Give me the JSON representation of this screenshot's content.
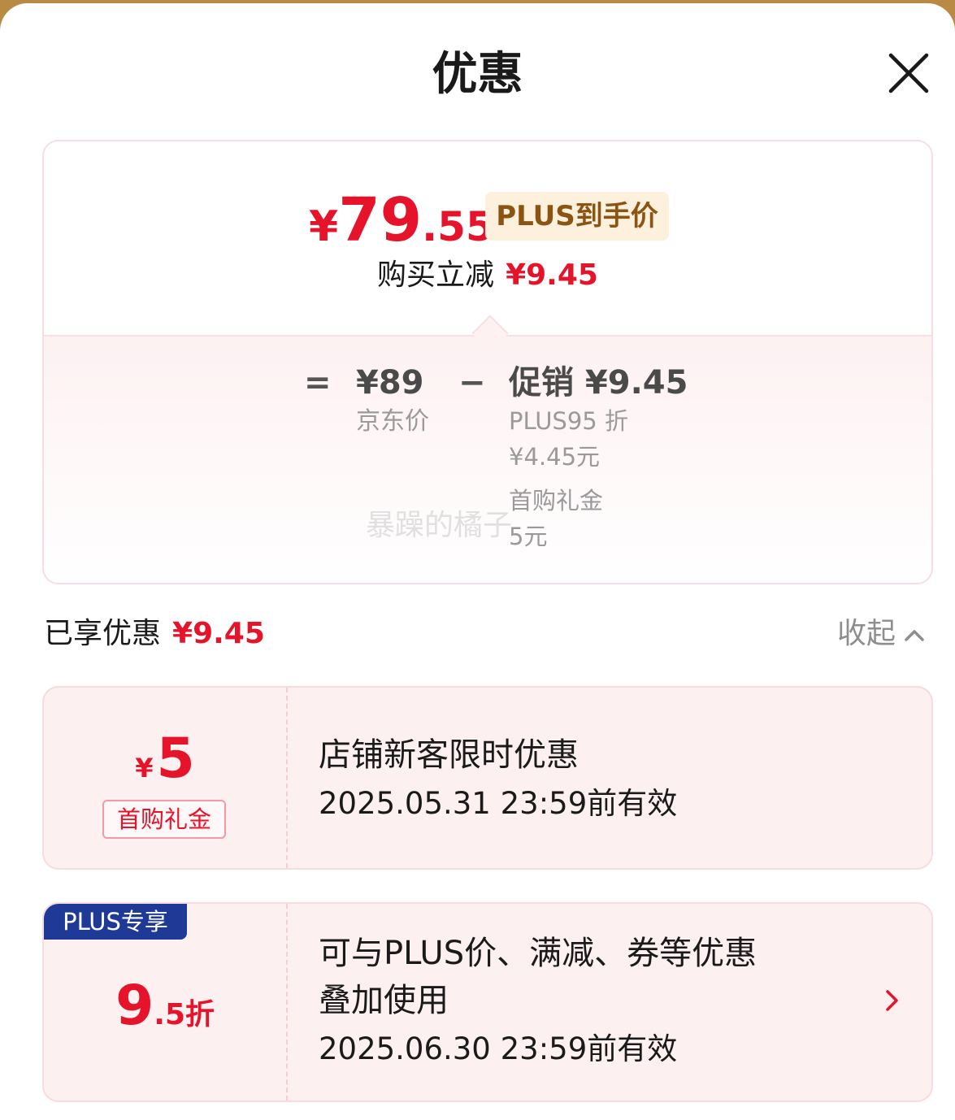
{
  "dialog": {
    "title": "优惠"
  },
  "price_card": {
    "currency_symbol": "¥",
    "final_price_int": "79",
    "final_price_dec": ".55",
    "final_price_label": "PLUS到手价",
    "reduce_label": "购买立减",
    "reduce_amount": "¥9.45",
    "breakdown": {
      "equals": "=",
      "jd_price": "¥89",
      "jd_price_label": "京东价",
      "minus": "−",
      "promo_title": "促销 ¥9.45",
      "promo_details": [
        "PLUS95 折",
        "¥4.45元",
        "首购礼金",
        "5元"
      ]
    },
    "watermark": "暴躁的橘子"
  },
  "savings": {
    "label": "已享优惠",
    "amount": "¥9.45",
    "collapse_label": "收起"
  },
  "coupons": [
    {
      "currency_symbol": "¥",
      "amount": "5",
      "tag": "首购礼金",
      "title": "店铺新客限时优惠",
      "valid": "2025.05.31 23:59前有效"
    },
    {
      "badge": "PLUS专享",
      "discount_big": "9",
      "discount_small": ".5折",
      "title_line1": "可与PLUS价、满减、券等优惠",
      "title_line2": "叠加使用",
      "valid": "2025.06.30 23:59前有效"
    }
  ],
  "colors": {
    "accent_red": "#e5142a",
    "plus_blue": "#1e3a96",
    "plus_gold_bg": "#fdf0dd",
    "plus_gold_text": "#8b5412"
  }
}
